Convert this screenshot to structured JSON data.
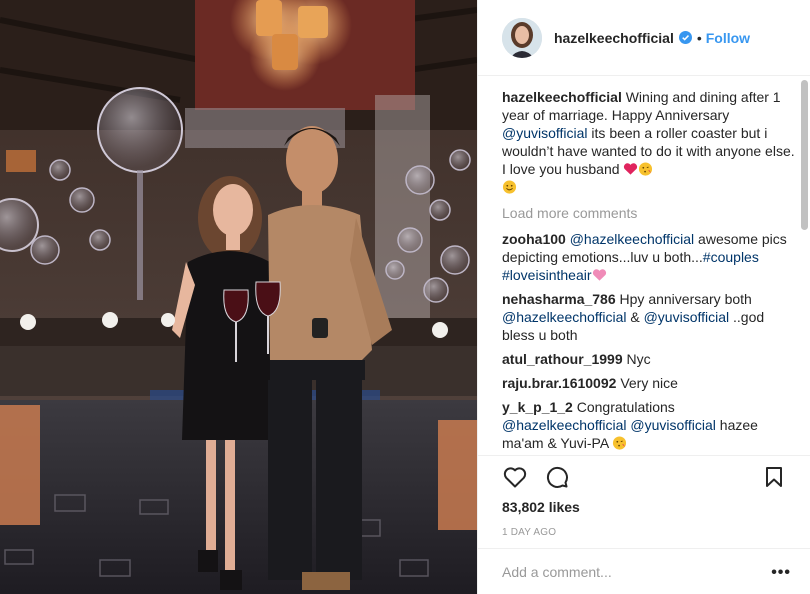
{
  "post": {
    "username": "hazelkeechofficial",
    "follow_label": "Follow",
    "dot": "•",
    "caption": {
      "username": "hazelkeechofficial",
      "text_1": "Wining and dining after 1 year of marriage. Happy Anniversary ",
      "mention": "@yuvisofficial",
      "text_2": " its been a roller coaster but i wouldn’t have wanted to do it with anyone else. I love you husband"
    },
    "load_more": "Load more comments",
    "comments": [
      {
        "username": "zooha100",
        "mention": "@hazelkeechofficial",
        "text": " awesome pics depicting emotions...luv u both...",
        "hashtag_1": "#couples",
        "hashtag_2": "#loveisintheair"
      },
      {
        "username": "nehasharma_786",
        "text_1": "Hpy anniversary both ",
        "mention_1": "@hazelkeechofficial",
        "text_2": " & ",
        "mention_2": "@yuvisofficial",
        "text_3": " ..god bless u both"
      },
      {
        "username": "atul_rathour_1999",
        "text": "Nyc"
      },
      {
        "username": "raju.brar.1610092",
        "text": "Very nice"
      },
      {
        "username": "y_k_p_1_2",
        "text_1": "Congratulations ",
        "mention_1": "@hazelkeechofficial",
        "text_2": " ",
        "mention_2": "@yuvisofficial",
        "text_3": " hazee ma'am & Yuvi-PA"
      }
    ],
    "likes": "83,802 likes",
    "time_ago": "1 DAY AGO",
    "add_comment_placeholder": "Add a comment...",
    "more_label": "•••"
  },
  "icons": [
    "heart-icon",
    "comment-icon",
    "bookmark-icon",
    "verified-badge-icon",
    "more-options-icon"
  ],
  "colors": {
    "link_blue": "#3897f0",
    "mention_blue": "#003569",
    "muted_gray": "#999999",
    "text": "#262626",
    "border": "#efefef"
  }
}
